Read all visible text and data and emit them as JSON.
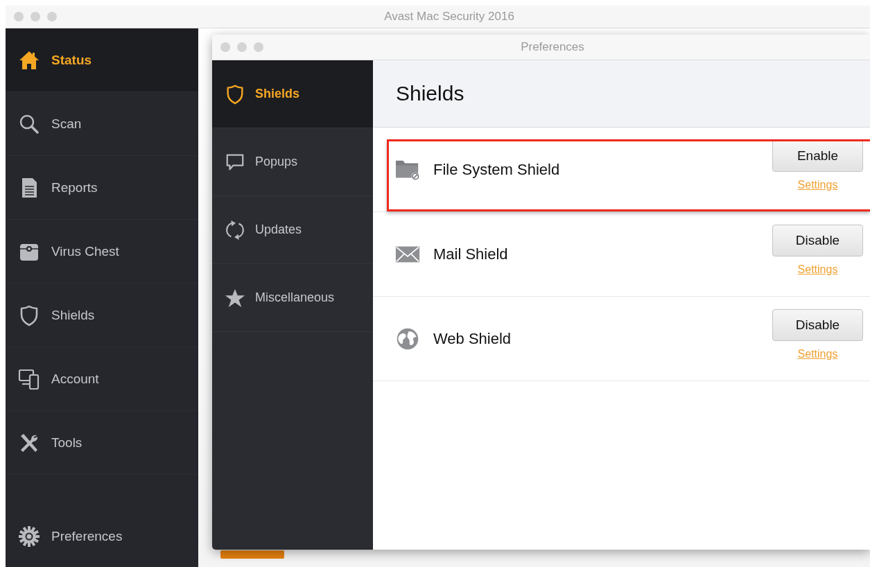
{
  "main_window": {
    "title": "Avast Mac Security 2016",
    "sidebar": {
      "items": [
        {
          "label": "Status",
          "kind": "home",
          "selected": true
        },
        {
          "label": "Scan",
          "kind": "search",
          "selected": false
        },
        {
          "label": "Reports",
          "kind": "document",
          "selected": false
        },
        {
          "label": "Virus Chest",
          "kind": "chest",
          "selected": false
        },
        {
          "label": "Shields",
          "kind": "shield",
          "selected": false
        },
        {
          "label": "Account",
          "kind": "devices",
          "selected": false
        },
        {
          "label": "Tools",
          "kind": "tools",
          "selected": false
        },
        {
          "label": "Preferences",
          "kind": "gear",
          "selected": false
        }
      ]
    }
  },
  "preferences_window": {
    "title": "Preferences",
    "sidebar": {
      "items": [
        {
          "label": "Shields",
          "kind": "shield",
          "selected": true
        },
        {
          "label": "Popups",
          "kind": "bubble",
          "selected": false
        },
        {
          "label": "Updates",
          "kind": "refresh",
          "selected": false
        },
        {
          "label": "Miscellaneous",
          "kind": "star",
          "selected": false
        }
      ]
    },
    "heading": "Shields",
    "shields": [
      {
        "name": "File System Shield",
        "kind": "folder",
        "button": "Enable",
        "link": "Settings",
        "highlighted": true
      },
      {
        "name": "Mail Shield",
        "kind": "mail",
        "button": "Disable",
        "link": "Settings",
        "highlighted": false
      },
      {
        "name": "Web Shield",
        "kind": "globe",
        "button": "Disable",
        "link": "Settings",
        "highlighted": false
      }
    ]
  }
}
